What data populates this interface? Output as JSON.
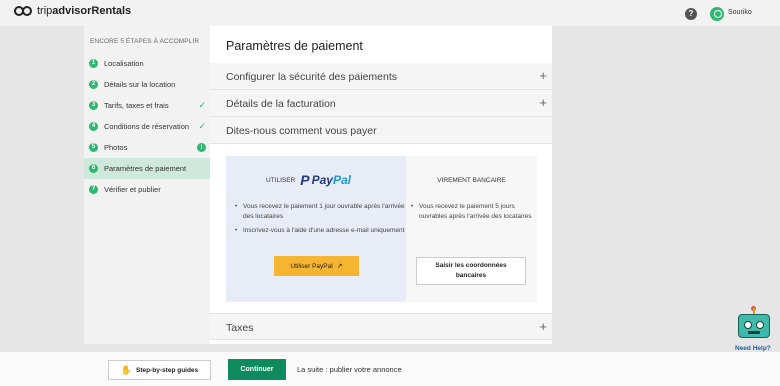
{
  "header": {
    "brand_trip": "trip",
    "brand_advisor": "advisor",
    "brand_rentals": " Rentals",
    "help_label": "?",
    "username": "Souriko"
  },
  "sidebar": {
    "heading": "ENCORE 5 ÉTAPES À ACCOMPLIR",
    "steps": [
      {
        "num": "1",
        "label": "Localisation",
        "status": ""
      },
      {
        "num": "2",
        "label": "Détails sur la location",
        "status": ""
      },
      {
        "num": "3",
        "label": "Tarifs, taxes et frais",
        "status": "✓"
      },
      {
        "num": "4",
        "label": "Conditions de réservation",
        "status": "✓"
      },
      {
        "num": "5",
        "label": "Photos",
        "status": "!"
      },
      {
        "num": "6",
        "label": "Paramètres de paiement",
        "status": ""
      },
      {
        "num": "7",
        "label": "Vérifier et publier",
        "status": ""
      }
    ]
  },
  "main": {
    "title": "Paramètres de paiement",
    "sections": [
      {
        "label": "Configurer la sécurité des paiements",
        "icon": "+"
      },
      {
        "label": "Détails de la facturation",
        "icon": "+"
      },
      {
        "label": "Dites-nous comment vous payer"
      },
      {
        "label": "Taxes",
        "icon": "+"
      }
    ],
    "paypal": {
      "use_label": "UTILISER",
      "logo_p": "P",
      "logo_pay": "Pay",
      "logo_pal": "Pal",
      "bullets": [
        "Vous recevez le paiement 1 jour ouvrable après l'arrivée des locataires",
        "Inscrivez-vous à l'aide d'une adresse e-mail uniquement"
      ],
      "button_label": "Utiliser PayPal",
      "button_icon": "external-link-icon"
    },
    "bank": {
      "heading": "VIREMENT BANCAIRE",
      "bullets": [
        "Vous recevez le paiement 5 jours ouvrables après l'arrivée des locataires"
      ],
      "button_label": "Saisir les coordonnées bancaires"
    }
  },
  "footer": {
    "guides_label": "Step-by-step guides",
    "continue_label": "Continuer",
    "next_text": "La suite : publier votre annonce"
  },
  "assistant": {
    "label": "Need Help?"
  },
  "colors": {
    "accent_green": "#2eb872",
    "continue_green": "#0e8a5f",
    "paypal_button": "#f6b530",
    "active_step_bg": "#cfe8dc"
  }
}
